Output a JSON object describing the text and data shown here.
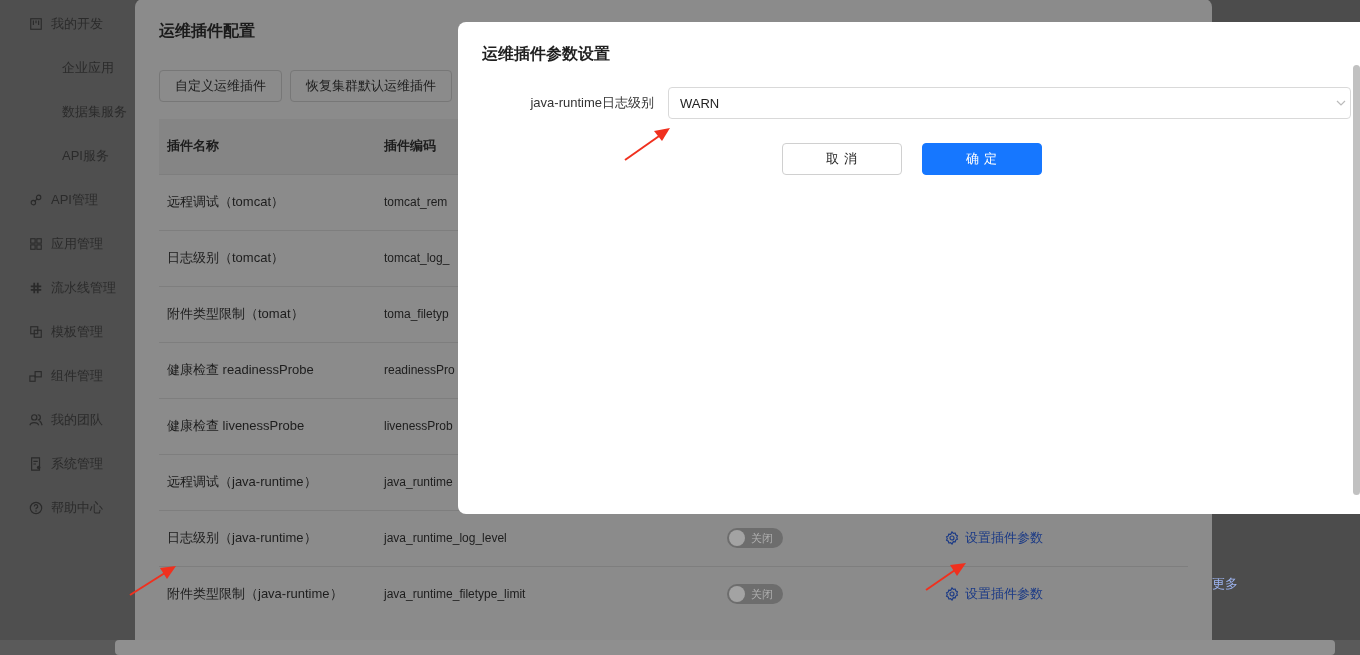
{
  "sidebar": {
    "items": [
      {
        "label": "我的开发",
        "children": [
          {
            "label": "企业应用"
          },
          {
            "label": "数据集服务"
          },
          {
            "label": "API服务"
          }
        ]
      },
      {
        "label": "API管理"
      },
      {
        "label": "应用管理"
      },
      {
        "label": "流水线管理"
      },
      {
        "label": "模板管理"
      },
      {
        "label": "组件管理"
      },
      {
        "label": "我的团队"
      },
      {
        "label": "系统管理"
      },
      {
        "label": "帮助中心"
      }
    ]
  },
  "background": {
    "links": [
      "更多"
    ]
  },
  "plugin_dialog": {
    "title": "运维插件配置",
    "buttons": [
      "自定义运维插件",
      "恢复集群默认运维插件"
    ],
    "table": {
      "columns": [
        "插件名称",
        "插件编码"
      ],
      "rows": [
        {
          "name": "远程调试（tomcat）",
          "code": "tomcat_rem"
        },
        {
          "name": "日志级别（tomcat）",
          "code": "tomcat_log_"
        },
        {
          "name": "附件类型限制（tomat）",
          "code": "toma_filetyp"
        },
        {
          "name": "健康检查 readinessProbe",
          "code": "readinessPro"
        },
        {
          "name": "健康检查 livenessProbe",
          "code": "livenessProb"
        },
        {
          "name": "远程调试（java-runtime）",
          "code": "java_runtime"
        },
        {
          "name": "日志级别（java-runtime）",
          "code": "java_runtime_log_level",
          "switch": {
            "label": "关闭",
            "on": false
          },
          "action": "设置插件参数"
        },
        {
          "name": "附件类型限制（java-runtime）",
          "code": "java_runtime_filetype_limit",
          "switch": {
            "label": "关闭",
            "on": false
          },
          "action": "设置插件参数"
        }
      ]
    }
  },
  "param_dialog": {
    "title": "运维插件参数设置",
    "field": {
      "label": "java-runtime日志级别",
      "value": "WARN"
    },
    "buttons": [
      {
        "label": "取 消",
        "kind": "secondary"
      },
      {
        "label": "确 定",
        "kind": "primary"
      }
    ]
  }
}
